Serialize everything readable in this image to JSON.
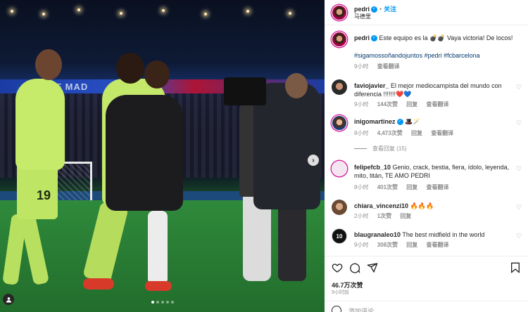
{
  "post": {
    "username": "pedri",
    "follow_label": "关注",
    "location": "马德里",
    "separator": "•"
  },
  "caption": {
    "username": "pedri",
    "text": "Este equipo es la 💣💣 Vaya victoria! De locos!",
    "hashtags": "#sigamossoñandojuntos #pedri #fcbarcelona",
    "time": "9小时",
    "translate": "查看翻译"
  },
  "comments": [
    {
      "username": "faviojavier_",
      "text": "El mejor mediocampista del mundo con diferencia !!!!!!!❤️💙",
      "time": "9小时",
      "likes": "144次赞",
      "reply": "回复",
      "translate": "查看翻译"
    },
    {
      "username": "inigomartinez",
      "text": "🎩🪄",
      "time": "8小时",
      "likes": "4,473次赞",
      "reply": "回复",
      "translate": "查看翻译",
      "view_replies": "查看回复 (15)"
    },
    {
      "username": "felipefcb_10",
      "text": "Genio, crack, bestia, fiera, ídolo, leyenda, mito, titán, TE AMO PEDRI",
      "time": "8小时",
      "likes": "401次赞",
      "reply": "回复",
      "translate": "查看翻译"
    },
    {
      "username": "chiara_vincenzi10",
      "text": "🔥🔥🔥",
      "time": "2小时",
      "likes": "1次赞",
      "reply": "回复"
    },
    {
      "username": "blaugranaleo10",
      "text": "The best midfield in the world",
      "time": "9小时",
      "likes": "308次赞",
      "reply": "回复",
      "translate": "查看翻译"
    }
  ],
  "footer": {
    "likes": "46.7万次赞",
    "time": "9小时前",
    "add_comment_placeholder": "添加评论..."
  },
  "photo": {
    "banner_text": "CITY OF MAD",
    "jersey_number": "19",
    "avatar_badge_text": "10"
  },
  "icons": {
    "like": "heart-icon",
    "comment": "comment-icon",
    "share": "share-icon",
    "save": "bookmark-icon",
    "next": "chevron-right-icon",
    "user_tag": "user-tag-icon"
  },
  "colors": {
    "accent_blue": "#0095f6",
    "hashtag": "#00376b",
    "muted": "#8e8e8e"
  }
}
